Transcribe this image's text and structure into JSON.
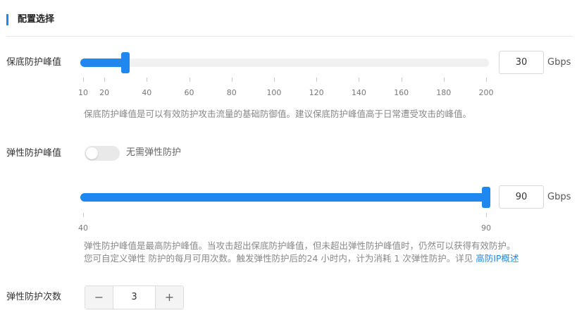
{
  "section": {
    "title": "配置选择"
  },
  "base": {
    "label": "保底防护峰值",
    "value": "30",
    "unit": "Gbps",
    "slider_min": 10,
    "slider_max": 200,
    "slider_value": 30,
    "ticks": [
      "10",
      "20",
      "40",
      "60",
      "80",
      "100",
      "120",
      "140",
      "160",
      "180",
      "200"
    ],
    "help": "保底防护峰值是可以有效防护攻击流量的基础防御值。建议保底防护峰值高于日常遭受攻击的峰值。"
  },
  "elastic": {
    "label": "弹性防护峰值",
    "toggle_text": "无需弹性防护",
    "toggle_on": false,
    "value": "90",
    "unit": "Gbps",
    "slider_min": 40,
    "slider_max": 90,
    "slider_value": 90,
    "ticks": [
      "40",
      "90"
    ],
    "help_line1": "弹性防护峰值是最高防护峰值。当攻击超出保底防护峰值，但未超出弹性防护峰值时，仍然可以获得有效防护。",
    "help_line2": "您可自定义弹性 防护的每月可用次数。触发弹性防护后的24 小时内，计为消耗 1 次弹性防护。详见 ",
    "help_link": "高防IP概述"
  },
  "count": {
    "label": "弹性防护次数",
    "value": "3",
    "minus": "−",
    "plus": "+"
  },
  "colors": {
    "accent": "#1e88f0",
    "track": "#f1f1f1"
  }
}
